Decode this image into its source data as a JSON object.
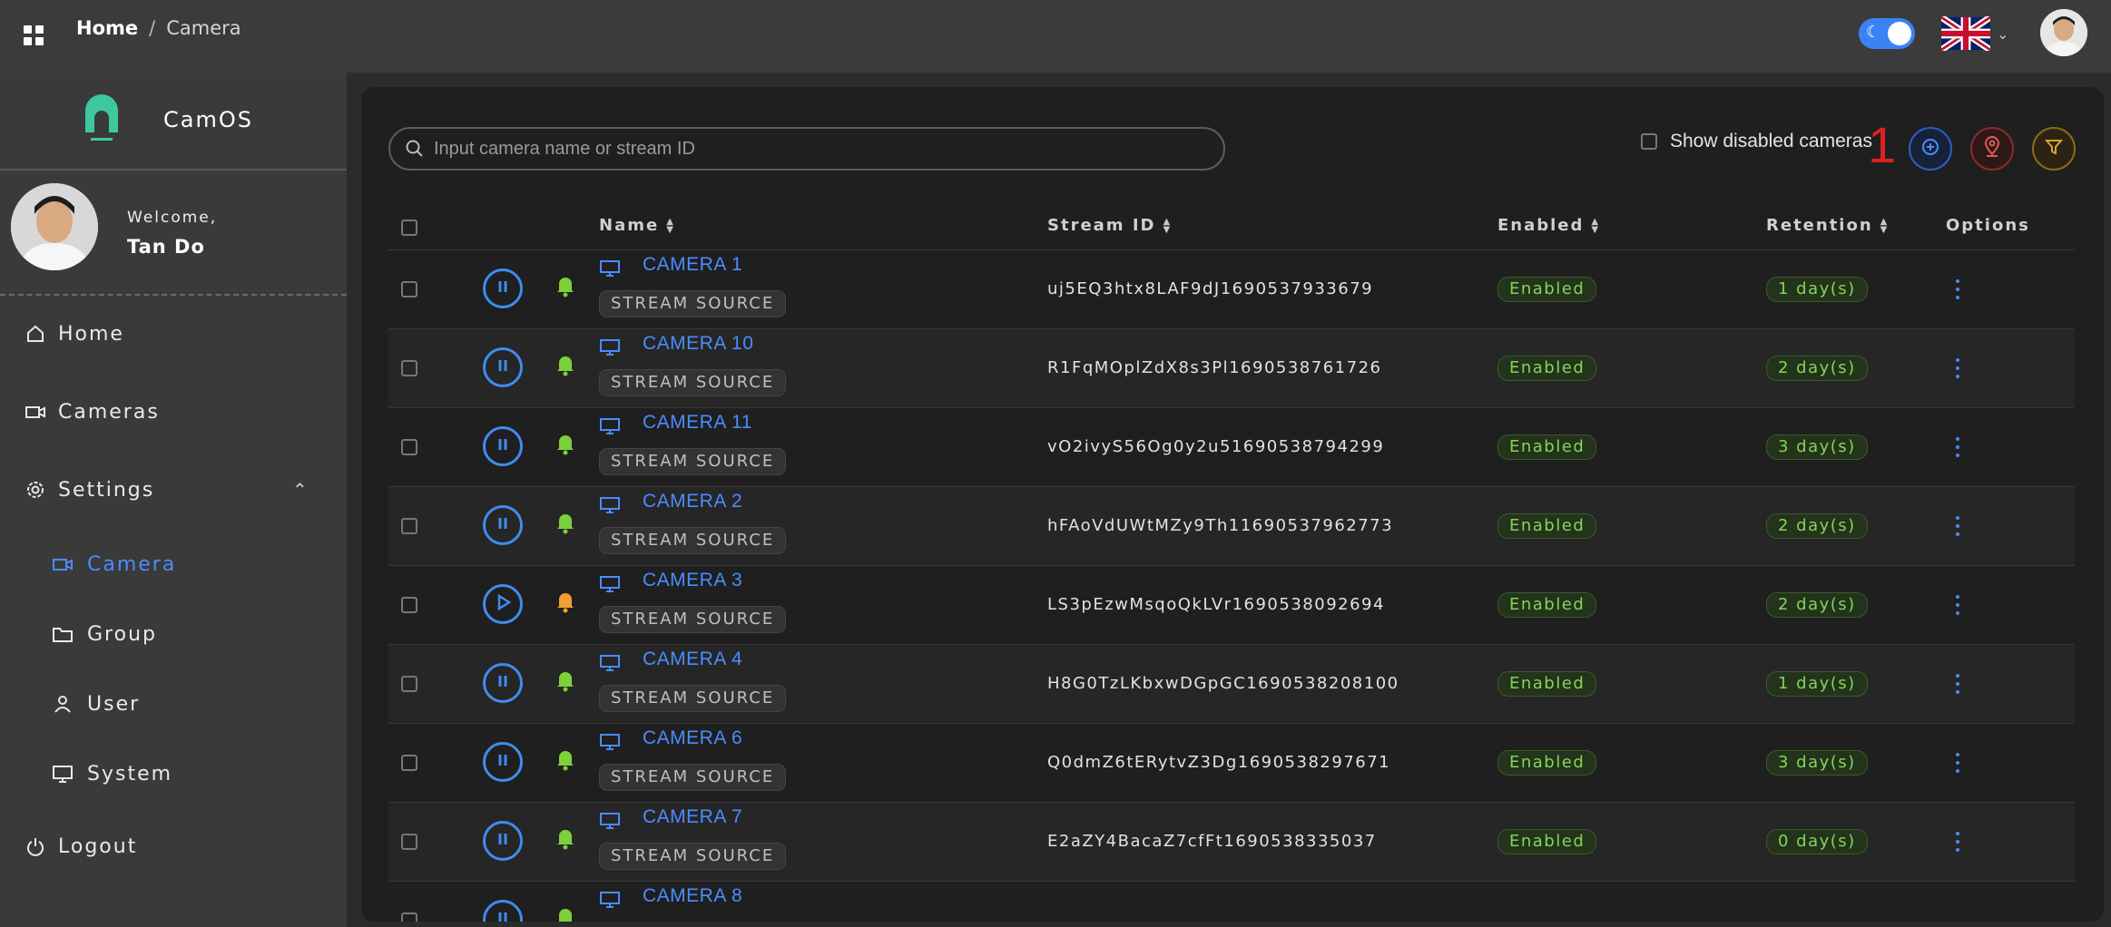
{
  "header": {
    "breadcrumb_home": "Home",
    "breadcrumb_sep": "/",
    "breadcrumb_current": "Camera",
    "theme_toggle": "on",
    "language_flag": "uk-flag-icon"
  },
  "sidebar": {
    "brand_name": "CamOS",
    "welcome": "Welcome,",
    "user_name": "Tan Do",
    "items": [
      {
        "label": "Home",
        "icon": "home-icon"
      },
      {
        "label": "Cameras",
        "icon": "video-camera-icon"
      },
      {
        "label": "Settings",
        "icon": "gear-icon"
      },
      {
        "label": "Camera",
        "icon": "video-camera-icon",
        "active": true
      },
      {
        "label": "Group",
        "icon": "folder-icon"
      },
      {
        "label": "User",
        "icon": "user-icon"
      },
      {
        "label": "System",
        "icon": "monitor-icon"
      },
      {
        "label": "Logout",
        "icon": "power-icon"
      }
    ]
  },
  "toolbar": {
    "search_placeholder": "Input camera name or stream ID",
    "show_disabled_label": "Show disabled cameras",
    "annotation": "1"
  },
  "table": {
    "columns": [
      "Name",
      "Stream ID",
      "Enabled",
      "Retention",
      "Options"
    ],
    "source_tag": "STREAM SOURCE",
    "rows": [
      {
        "name": "CAMERA 1",
        "stream_id": "uj5EQ3htx8LAF9dJ1690537933679",
        "enabled": "Enabled",
        "retention": "1 day(s)",
        "state": "playing",
        "bell": "green"
      },
      {
        "name": "CAMERA 10",
        "stream_id": "R1FqMOplZdX8s3Pl1690538761726",
        "enabled": "Enabled",
        "retention": "2 day(s)",
        "state": "playing",
        "bell": "green"
      },
      {
        "name": "CAMERA 11",
        "stream_id": "vO2ivyS56Og0y2u51690538794299",
        "enabled": "Enabled",
        "retention": "3 day(s)",
        "state": "playing",
        "bell": "green"
      },
      {
        "name": "CAMERA 2",
        "stream_id": "hFAoVdUWtMZy9Th11690537962773",
        "enabled": "Enabled",
        "retention": "2 day(s)",
        "state": "playing",
        "bell": "green"
      },
      {
        "name": "CAMERA 3",
        "stream_id": "LS3pEzwMsqoQkLVr1690538092694",
        "enabled": "Enabled",
        "retention": "2 day(s)",
        "state": "paused",
        "bell": "orange"
      },
      {
        "name": "CAMERA 4",
        "stream_id": "H8G0TzLKbxwDGpGC1690538208100",
        "enabled": "Enabled",
        "retention": "1 day(s)",
        "state": "playing",
        "bell": "green"
      },
      {
        "name": "CAMERA 6",
        "stream_id": "Q0dmZ6tERytvZ3Dg1690538297671",
        "enabled": "Enabled",
        "retention": "3 day(s)",
        "state": "playing",
        "bell": "green"
      },
      {
        "name": "CAMERA 7",
        "stream_id": "E2aZY4BacaZ7cfFt1690538335037",
        "enabled": "Enabled",
        "retention": "0 day(s)",
        "state": "playing",
        "bell": "green"
      },
      {
        "name": "CAMERA 8",
        "stream_id": "",
        "enabled": "",
        "retention": "",
        "state": "playing",
        "bell": "green"
      }
    ]
  },
  "colors": {
    "accent": "#4a8cff",
    "enabled_text": "#83d656",
    "bell_green": "#7bd13a",
    "bell_orange": "#f0a030",
    "annotation": "#e02020"
  }
}
